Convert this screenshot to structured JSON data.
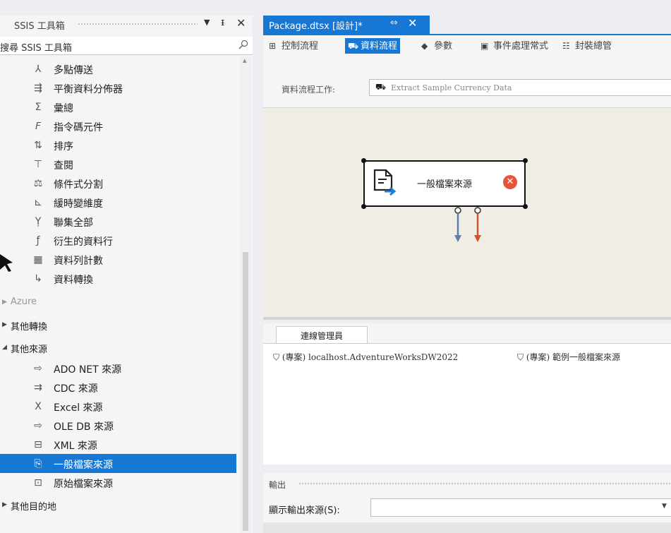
{
  "toolbox": {
    "title": "SSIS 工具箱",
    "search_placeholder": "搜尋 SSIS 工具箱",
    "items": [
      {
        "label": "多點傳送",
        "icon": "multicast-icon",
        "glyph": "⅄"
      },
      {
        "label": "平衡資料分佈器",
        "icon": "balanced-distributor-icon",
        "glyph": "⇶"
      },
      {
        "label": "彙總",
        "icon": "aggregate-icon",
        "glyph": "Σ"
      },
      {
        "label": "指令碼元件",
        "icon": "script-component-icon",
        "glyph": "𝘍"
      },
      {
        "label": "排序",
        "icon": "sort-icon",
        "glyph": "⇅"
      },
      {
        "label": "查閱",
        "icon": "lookup-icon",
        "glyph": "⊤"
      },
      {
        "label": "條件式分割",
        "icon": "conditional-split-icon",
        "glyph": "⚖"
      },
      {
        "label": "緩時變維度",
        "icon": "scd-icon",
        "glyph": "⊾"
      },
      {
        "label": "聯集全部",
        "icon": "union-all-icon",
        "glyph": "Ỵ"
      },
      {
        "label": "衍生的資料行",
        "icon": "derived-column-icon",
        "glyph": "ƒ"
      },
      {
        "label": "資料列計數",
        "icon": "row-count-icon",
        "glyph": "▦"
      },
      {
        "label": "資料轉換",
        "icon": "data-conversion-icon",
        "glyph": "↳"
      }
    ],
    "group_azure": "Azure",
    "group_other_transforms": "其他轉換",
    "group_other_sources": "其他來源",
    "sources": [
      {
        "label": "ADO NET 來源",
        "icon": "ado-net-source-icon",
        "glyph": "⇨"
      },
      {
        "label": "CDC 來源",
        "icon": "cdc-source-icon",
        "glyph": "⇉"
      },
      {
        "label": "Excel 來源",
        "icon": "excel-source-icon",
        "glyph": "X"
      },
      {
        "label": "OLE DB 來源",
        "icon": "oledb-source-icon",
        "glyph": "⇨"
      },
      {
        "label": "XML 來源",
        "icon": "xml-source-icon",
        "glyph": "⊟"
      },
      {
        "label": "一般檔案來源",
        "icon": "flat-file-source-icon",
        "glyph": "⎘"
      },
      {
        "label": "原始檔案來源",
        "icon": "raw-file-source-icon",
        "glyph": "⊡"
      }
    ],
    "group_other_destinations": "其他目的地"
  },
  "document": {
    "tab_label": "Package.dtsx [設計]*",
    "designer_tabs": [
      {
        "label": "控制流程",
        "glyph": "⊞"
      },
      {
        "label": "資料流程",
        "glyph": "⛟"
      },
      {
        "label": "參數",
        "glyph": "◆"
      },
      {
        "label": "事件處理常式",
        "glyph": "▣"
      },
      {
        "label": "封裝總管",
        "glyph": "☷"
      }
    ],
    "task_label": "資料流程工作:",
    "task_value": "Extract Sample Currency Data"
  },
  "canvas": {
    "node_label": "一般檔案來源"
  },
  "connections": {
    "tab_label": "連線管理員",
    "items": [
      "(專案) localhost.AdventureWorksDW2022",
      "(專案) 範例一般檔案來源"
    ]
  },
  "output": {
    "title": "輸出",
    "source_label": "顯示輸出來源(S):"
  },
  "colors": {
    "accent": "#1777d4",
    "canvas": "#f0ede4",
    "error": "#e2563b",
    "arrow_blue": "#5b7fa6",
    "arrow_red": "#d2522b"
  }
}
